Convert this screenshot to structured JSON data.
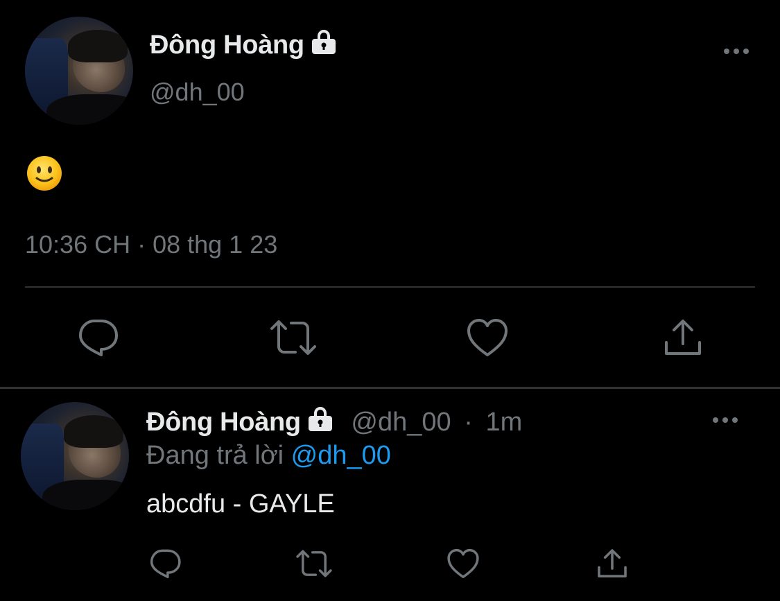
{
  "main_tweet": {
    "author": {
      "display_name": "Đông Hoàng",
      "handle": "@dh_00",
      "protected": true,
      "avatar": "profile-photo"
    },
    "content_emoji": "🙂",
    "timestamp": "10:36 CH · 08 thg 1 23",
    "actions": [
      "reply-icon",
      "retweet-icon",
      "like-icon",
      "share-icon"
    ]
  },
  "reply_tweet": {
    "author": {
      "display_name": "Đông Hoàng",
      "handle": "@dh_00",
      "protected": true,
      "avatar": "profile-photo"
    },
    "separator": "·",
    "time": "1m",
    "replying_prefix": "Đang trả lời",
    "replying_to": "@dh_00",
    "text": "abcdfu - GAYLE",
    "actions": [
      "reply-icon",
      "retweet-icon",
      "like-icon",
      "share-icon"
    ]
  },
  "colors": {
    "background": "#000000",
    "primary_text": "#e7e9ea",
    "secondary_text": "#71767b",
    "mention": "#1d9bf0",
    "divider": "#2f3336"
  }
}
